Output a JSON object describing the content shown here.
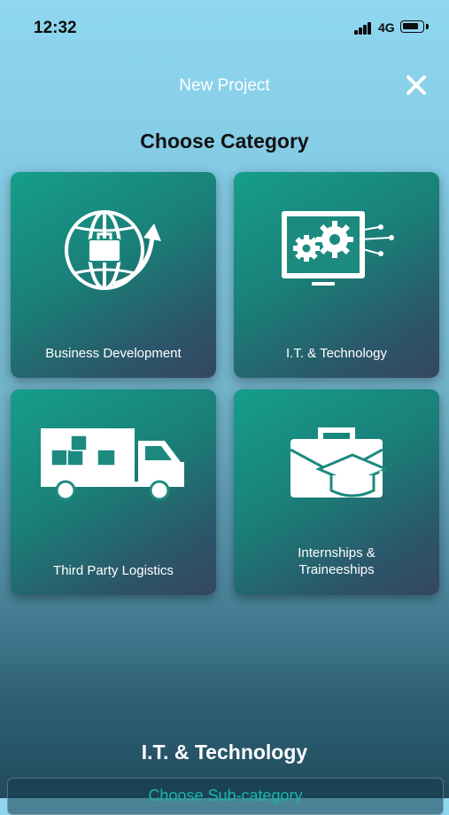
{
  "status_bar": {
    "time": "12:32",
    "network": "4G"
  },
  "header": {
    "title": "New Project",
    "close_icon": "close-icon"
  },
  "section_title": "Choose Category",
  "categories": [
    {
      "label": "Business Development",
      "icon": "globe-briefcase-icon"
    },
    {
      "label": "I.T. & Technology",
      "icon": "monitor-gears-icon"
    },
    {
      "label": "Third Party Logistics",
      "icon": "delivery-truck-icon"
    },
    {
      "label": "Internships &\nTraineeships",
      "icon": "briefcase-graduation-cap-icon"
    }
  ],
  "selected_category": "I.T. & Technology",
  "subcategory_placeholder": "Choose Sub-category",
  "colors": {
    "card_start": "#169e8a",
    "card_end": "#35475f",
    "accent": "#19b6a4",
    "background_top": "#8ed7ef"
  }
}
